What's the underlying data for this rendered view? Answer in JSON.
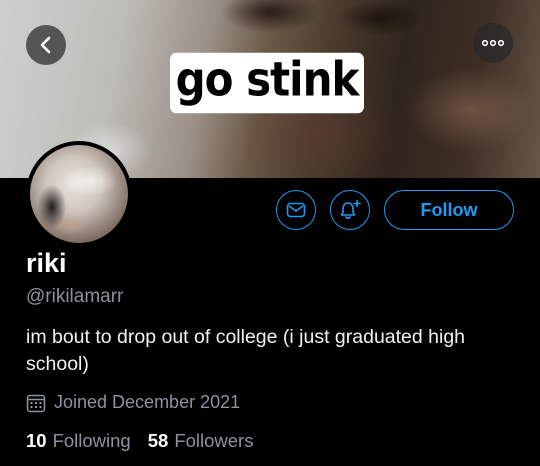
{
  "banner": {
    "caption": "go stink"
  },
  "profile": {
    "name": "riki",
    "handle": "@rikilamarr",
    "bio": "im bout to drop out of college (i just graduated high school)",
    "joined": "Joined December 2021",
    "following_count": "10",
    "following_label": "Following",
    "followers_count": "58",
    "followers_label": "Followers"
  },
  "actions": {
    "follow_label": "Follow"
  },
  "icons": {
    "back": "chevron-left-icon",
    "more": "more-dots-icon",
    "message": "envelope-icon",
    "notify": "bell-plus-icon",
    "calendar": "calendar-icon"
  },
  "colors": {
    "accent": "#1d9bf0",
    "background": "#000000",
    "secondary_text": "#8b949c"
  }
}
